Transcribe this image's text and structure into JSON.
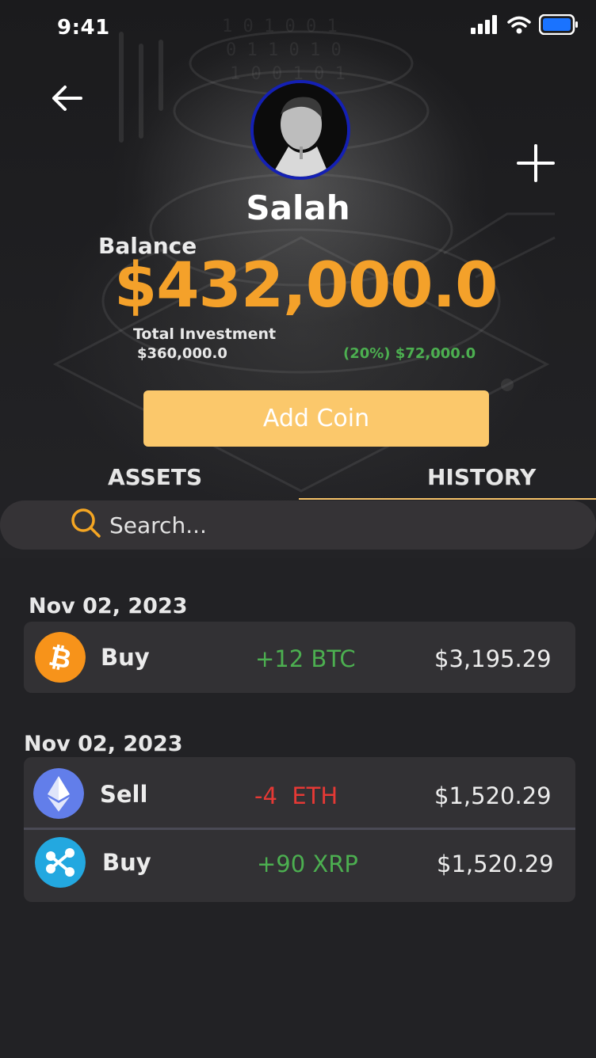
{
  "status_bar": {
    "time": "9:41"
  },
  "profile": {
    "name": "Salah",
    "balance_label": "Balance",
    "balance_value": "$432,000.0",
    "total_investment_label": "Total Investment",
    "total_investment_value": "$360,000.0",
    "profit_text": "(20%) $72,000.0"
  },
  "actions": {
    "add_coin_label": "Add Coin"
  },
  "tabs": [
    {
      "label": "ASSETS",
      "active": false
    },
    {
      "label": "HISTORY",
      "active": true
    }
  ],
  "search": {
    "placeholder": "Search..."
  },
  "history": [
    {
      "date": "Nov 02, 2023",
      "transactions": [
        {
          "type": "Buy",
          "amount": "+12 BTC",
          "value": "$3,195.29",
          "coin": "bitcoin-icon",
          "direction": "in"
        }
      ]
    },
    {
      "date": "Nov 02, 2023",
      "transactions": [
        {
          "type": "Sell",
          "amount": "-4  ETH",
          "value": "$1,520.29",
          "coin": "ethereum-icon",
          "direction": "out"
        },
        {
          "type": "Buy",
          "amount": "+90 XRP",
          "value": "$1,520.29",
          "coin": "xrp-icon",
          "direction": "in"
        }
      ]
    }
  ],
  "colors": {
    "accent_orange": "#f4a12a",
    "button_yellow": "#fbc86b",
    "positive_green": "#4caf50",
    "negative_red": "#e53935",
    "avatar_border": "#1420b4",
    "bitcoin": "#f7931a",
    "ethereum": "#627eea",
    "xrp": "#23a8e0"
  }
}
